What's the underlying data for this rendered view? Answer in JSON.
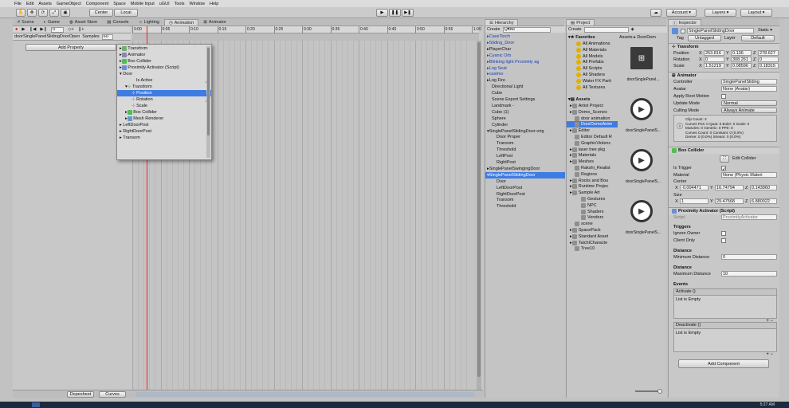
{
  "menu": [
    "File",
    "Edit",
    "Assets",
    "GameObject",
    "Component",
    "Space",
    "Mobile Input",
    "uGUI",
    "Tools",
    "Window",
    "Help"
  ],
  "toolbar": {
    "center": "Center",
    "local": "Local",
    "account": "Account",
    "layers": "Layers",
    "layout": "Layout"
  },
  "anim_tabs": [
    "Scene",
    "Game",
    "Asset Store",
    "Console",
    "Lighting",
    "Animation",
    "Animator"
  ],
  "anim": {
    "record": "●",
    "clip": "doorSinglePanelSlidingDoorOpen",
    "samples_label": "Samples",
    "samples": "60",
    "frame": "0",
    "add_property": "Add Property",
    "ticks": [
      "0:00",
      "0:05",
      "0:10",
      "0:15",
      "0:20",
      "0:25",
      "0:30",
      "0:35",
      "0:40",
      "0:45",
      "0:50",
      "0:55",
      "1:00"
    ],
    "dopesheet": "Dopesheet",
    "curves": "Curves"
  },
  "prop_tree": [
    "Transform",
    "Animator",
    "Box Collider",
    "Proximity Activator (Script)",
    "Door",
    "Is Active",
    "Transform",
    "Position",
    "Rotation",
    "Scale",
    "Box Collider",
    "Mesh Renderer",
    "LeftDoorPost",
    "RightDoorPost",
    "Transom"
  ],
  "hierarchy": {
    "title": "Hierarchy",
    "create": "Create",
    "search": "Q▾All",
    "items": [
      "CaveTorch",
      "Sliding_Door",
      "PlayerChar",
      "Cyanic Orb",
      "Blinking light Proximity ag",
      "Log Seat",
      "castmo",
      "Log Fire",
      "Directional Light",
      "Cube",
      "Scene Export Settings",
      "Landmark -",
      "Cube (1)",
      "Sphere",
      "Cylinder",
      "SinglePanelSlidingDoor-orig",
      "Door Proper",
      "Transom",
      "Threshold",
      "LeftPost",
      "RightPost",
      "SinglePanelSwingingDoor",
      "SinglePanelSlidingDoor",
      "Door",
      "LeftDoorPost",
      "RightDoorPost",
      "Transom",
      "Threshold"
    ]
  },
  "project": {
    "title": "Project",
    "create": "Create",
    "breadcrumb": "Assets ▸ DoorDem",
    "favorites": "Favorites",
    "fav_items": [
      "All Animations",
      "All Materials",
      "All Models",
      "All Prefabs",
      "All Scripts",
      "All Shaders",
      "Water FX Parti",
      "All Textures"
    ],
    "assets": "Assets",
    "asset_items": [
      "Artist Project",
      "Demo_Scenes",
      "door animation",
      "DoorDemoAnim",
      "Editor",
      "Editor Default R",
      "GraphicViolenc",
      "laser tree pkg",
      "Materials",
      "Meshes",
      "Rakshi_Realist",
      "Regions",
      "Rocks and Bou",
      "Runtime Projec",
      "Sample Art",
      "Gestures",
      "NPC",
      "Shaders",
      "Vendors",
      "scene",
      "SpacePack",
      "Standard Asset",
      "TaichiCharacte",
      "Tree10"
    ],
    "thumbs": [
      "doorSinglePanel...",
      "doorSinglePanelS...",
      "doorSinglePanelS...",
      "doorSinglePanelS..."
    ]
  },
  "inspector": {
    "title": "Inspector",
    "name": "SinglePanelSlidingDoor",
    "static": "Static",
    "tag_label": "Tag",
    "tag": "Untagged",
    "layer_label": "Layer",
    "layer": "Default",
    "transform": {
      "title": "Transform",
      "position": "Position",
      "rotation": "Rotation",
      "scale": "Scale",
      "px": "263.816",
      "py": "0.136",
      "pz": "278.627",
      "rx": "0",
      "ry": "308.261",
      "rz": "0",
      "sx": "1.51219",
      "sy": "0.08596",
      "sz": "0.18315"
    },
    "animator": {
      "title": "Animator",
      "controller_label": "Controller",
      "controller": "SinglePanelSliding",
      "avatar_label": "Avatar",
      "avatar": "None (Avatar)",
      "apply_label": "Apply Root Motion",
      "update_label": "Update Mode",
      "update": "Normal",
      "culling_label": "Culling Mode",
      "culling": "Always Animate",
      "info": [
        "Clip Count: 3",
        "Curves Pos: 0 Quat: 0 Euler: 0 Scale: 0",
        "Muscles: 0 Generic: 0 PPtr: 0",
        "Curves Count: 0 Constant: 0 (0.0%)",
        "Dense: 0 (0.0%) Stream: 0 (0.0%)"
      ]
    },
    "box": {
      "title": "Box Collider",
      "edit": "Edit Collider",
      "trigger": "Is Trigger",
      "material_label": "Material",
      "material": "None (Physic Materi",
      "center_label": "Center",
      "cx": "-0.004471",
      "cy": "16.74794",
      "cz": "0.143960",
      "size_label": "Size",
      "szx": "1",
      "szy": "29.47568",
      "szz": "6.880022"
    },
    "prox": {
      "title": "Proximity Activator (Script)",
      "script_label": "Script",
      "script": "ProximityActivator",
      "triggers": "Triggers",
      "ignore": "Ignore Owner",
      "client": "Client Only",
      "distance": "Distance",
      "min_label": "Minimum Distance",
      "min": "0",
      "distance2": "Distance",
      "max_label": "Maximum Distance",
      "max": "10",
      "events": "Events",
      "activate": "Activate ()",
      "deactivate": "Deactivate ()",
      "empty": "List is Empty",
      "add_component": "Add Component"
    }
  },
  "clock": "5:27 AM"
}
